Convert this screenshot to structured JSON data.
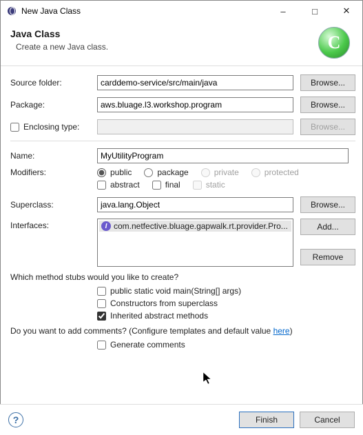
{
  "window": {
    "title": "New Java Class"
  },
  "header": {
    "title": "Java Class",
    "subtitle": "Create a new Java class.",
    "badge": "C"
  },
  "labels": {
    "source_folder": "Source folder:",
    "package": "Package:",
    "enclosing_type": "Enclosing type:",
    "name": "Name:",
    "modifiers": "Modifiers:",
    "superclass": "Superclass:",
    "interfaces": "Interfaces:"
  },
  "fields": {
    "source_folder": "carddemo-service/src/main/java",
    "package": "aws.bluage.l3.workshop.program",
    "enclosing_type": "",
    "name": "MyUtilityProgram",
    "superclass": "java.lang.Object"
  },
  "modifiers": {
    "visibility": {
      "public": "public",
      "package": "package",
      "private": "private",
      "protected": "protected"
    },
    "other": {
      "abstract": "abstract",
      "final": "final",
      "static": "static"
    }
  },
  "interfaces": [
    "com.netfective.bluage.gapwalk.rt.provider.Pro..."
  ],
  "buttons": {
    "browse": "Browse...",
    "add": "Add...",
    "remove": "Remove",
    "finish": "Finish",
    "cancel": "Cancel"
  },
  "stubs": {
    "question": "Which method stubs would you like to create?",
    "main": "public static void main(String[] args)",
    "constructors": "Constructors from superclass",
    "inherited": "Inherited abstract methods"
  },
  "comments": {
    "question_prefix": "Do you want to add comments? (Configure templates and default value ",
    "link": "here",
    "question_suffix": ")",
    "generate": "Generate comments"
  }
}
